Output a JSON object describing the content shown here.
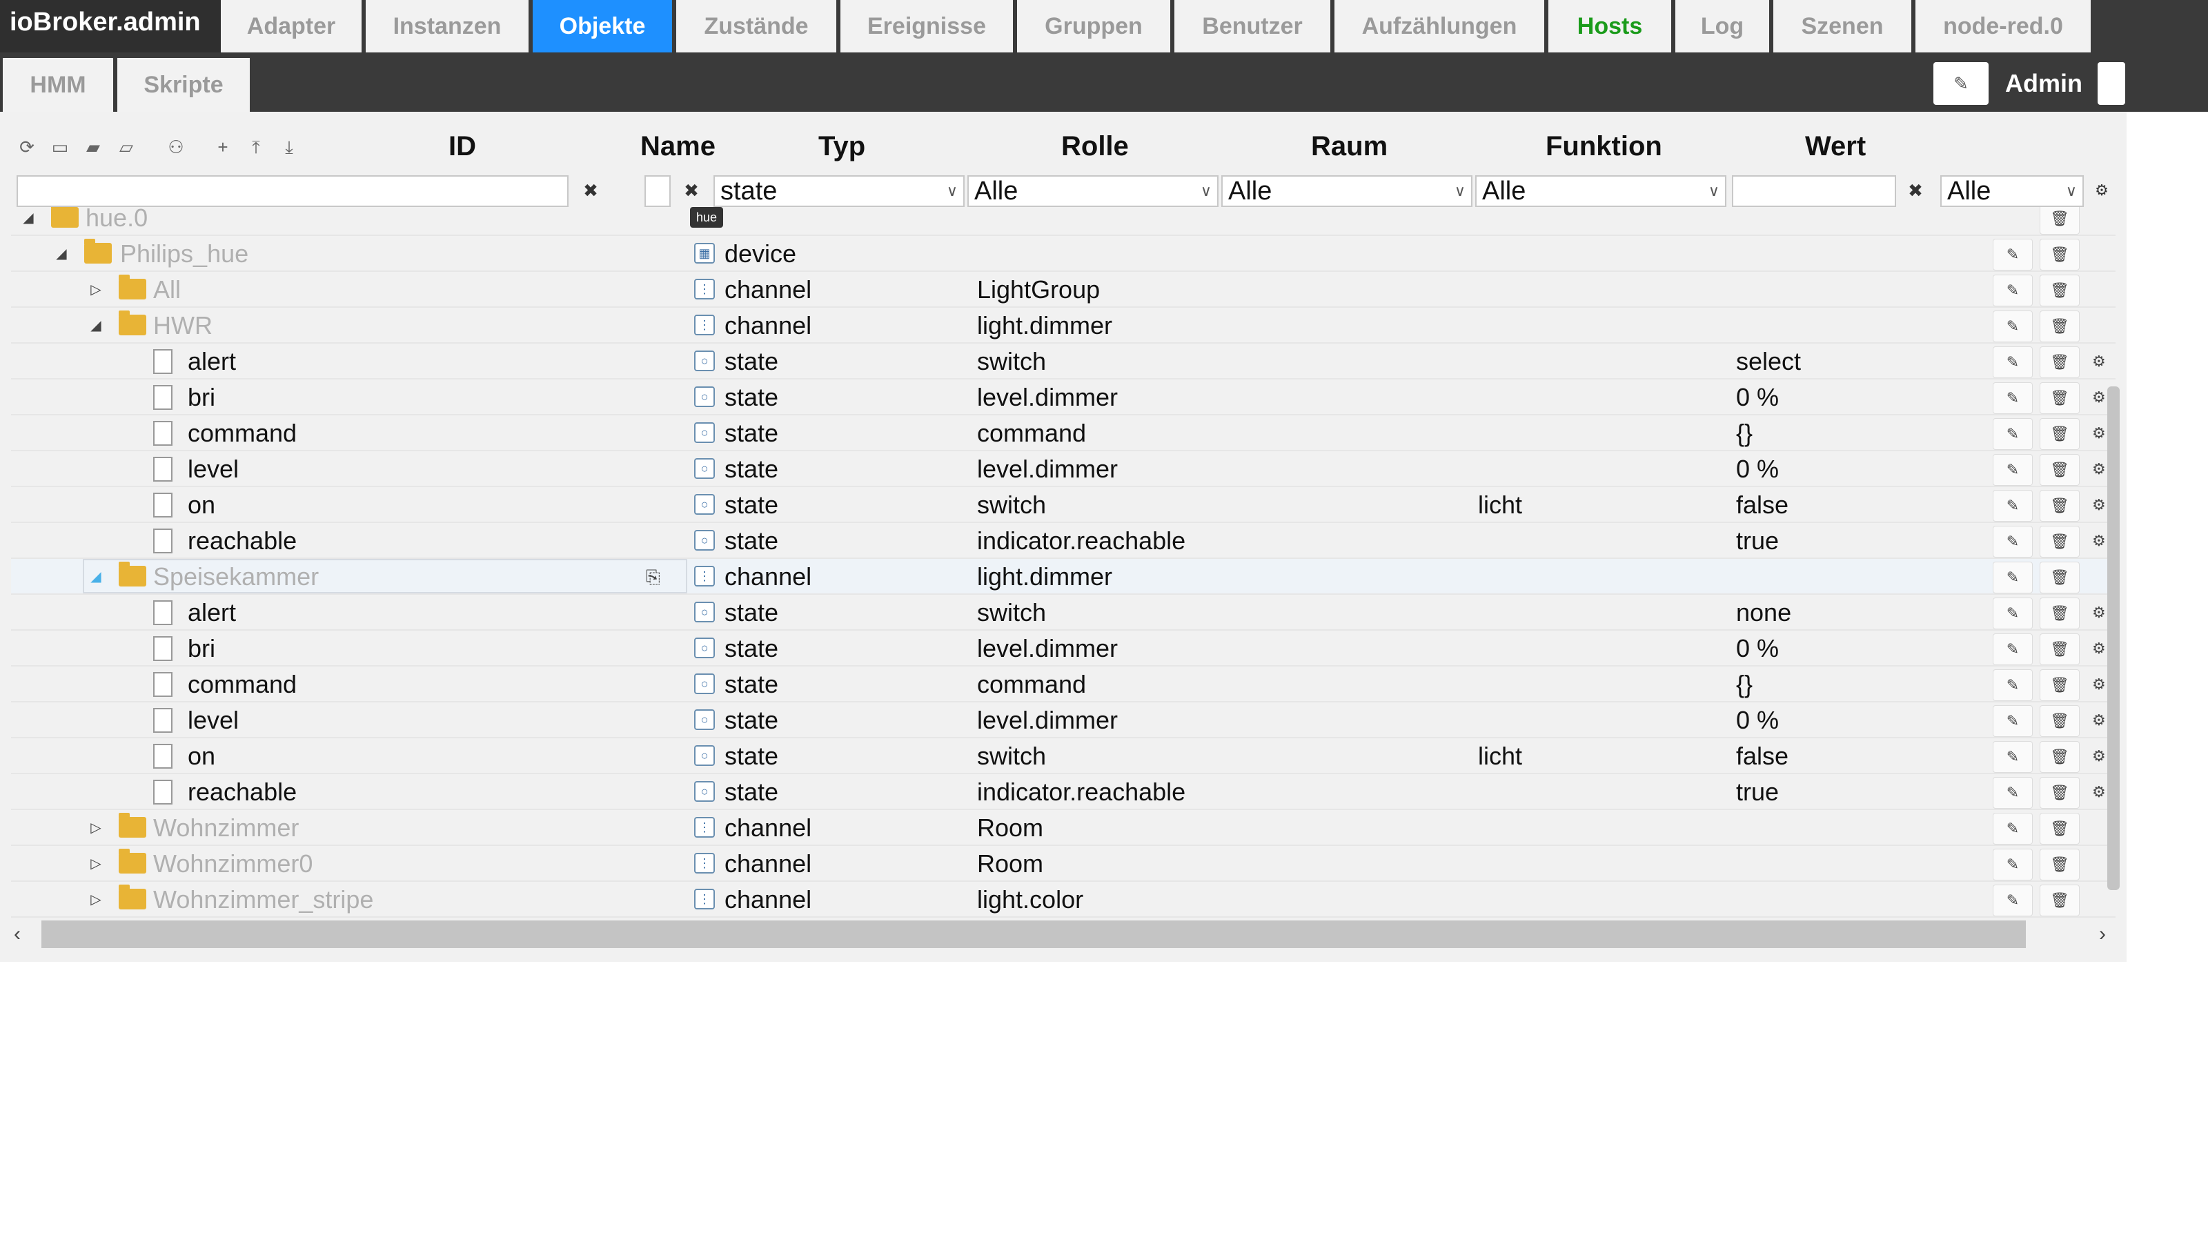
{
  "app": {
    "brand": "ioBroker.admin"
  },
  "tabs": [
    {
      "label": "Adapter"
    },
    {
      "label": "Instanzen"
    },
    {
      "label": "Objekte"
    },
    {
      "label": "Zustände"
    },
    {
      "label": "Ereignisse"
    },
    {
      "label": "Gruppen"
    },
    {
      "label": "Benutzer"
    },
    {
      "label": "Aufzählungen"
    },
    {
      "label": "Hosts"
    },
    {
      "label": "Log"
    },
    {
      "label": "Szenen"
    },
    {
      "label": "node-red.0"
    }
  ],
  "subtabs": [
    {
      "label": "HMM"
    },
    {
      "label": "Skripte"
    }
  ],
  "user": {
    "label": "Admin"
  },
  "columns": {
    "id": "ID",
    "name": "Name",
    "type": "Typ",
    "role": "Rolle",
    "room": "Raum",
    "function": "Funktion",
    "value": "Wert"
  },
  "filters": {
    "id": "",
    "type": "state",
    "role": "Alle",
    "room": "Alle",
    "function": "Alle",
    "value": "",
    "extra": "Alle"
  },
  "rows": [
    {
      "label": "hue.0",
      "type": "",
      "role": "",
      "func": "",
      "value": ""
    },
    {
      "label": "Philips_hue",
      "type": "device",
      "role": "",
      "func": "",
      "value": ""
    },
    {
      "label": "All",
      "type": "channel",
      "role": "LightGroup",
      "func": "",
      "value": ""
    },
    {
      "label": "HWR",
      "type": "channel",
      "role": "light.dimmer",
      "func": "",
      "value": ""
    },
    {
      "label": "alert",
      "type": "state",
      "role": "switch",
      "func": "",
      "value": "select"
    },
    {
      "label": "bri",
      "type": "state",
      "role": "level.dimmer",
      "func": "",
      "value": "0 %"
    },
    {
      "label": "command",
      "type": "state",
      "role": "command",
      "func": "",
      "value": "{}"
    },
    {
      "label": "level",
      "type": "state",
      "role": "level.dimmer",
      "func": "",
      "value": "0 %"
    },
    {
      "label": "on",
      "type": "state",
      "role": "switch",
      "func": "licht",
      "value": "false"
    },
    {
      "label": "reachable",
      "type": "state",
      "role": "indicator.reachable",
      "func": "",
      "value": "true"
    },
    {
      "label": "Speisekammer",
      "type": "channel",
      "role": "light.dimmer",
      "func": "",
      "value": ""
    },
    {
      "label": "alert",
      "type": "state",
      "role": "switch",
      "func": "",
      "value": "none"
    },
    {
      "label": "bri",
      "type": "state",
      "role": "level.dimmer",
      "func": "",
      "value": "0 %"
    },
    {
      "label": "command",
      "type": "state",
      "role": "command",
      "func": "",
      "value": "{}"
    },
    {
      "label": "level",
      "type": "state",
      "role": "level.dimmer",
      "func": "",
      "value": "0 %"
    },
    {
      "label": "on",
      "type": "state",
      "role": "switch",
      "func": "licht",
      "value": "false"
    },
    {
      "label": "reachable",
      "type": "state",
      "role": "indicator.reachable",
      "func": "",
      "value": "true"
    },
    {
      "label": "Wohnzimmer",
      "type": "channel",
      "role": "Room",
      "func": "",
      "value": ""
    },
    {
      "label": "Wohnzimmer0",
      "type": "channel",
      "role": "Room",
      "func": "",
      "value": ""
    },
    {
      "label": "Wohnzimmer_stripe",
      "type": "channel",
      "role": "light.color",
      "func": "",
      "value": ""
    }
  ]
}
